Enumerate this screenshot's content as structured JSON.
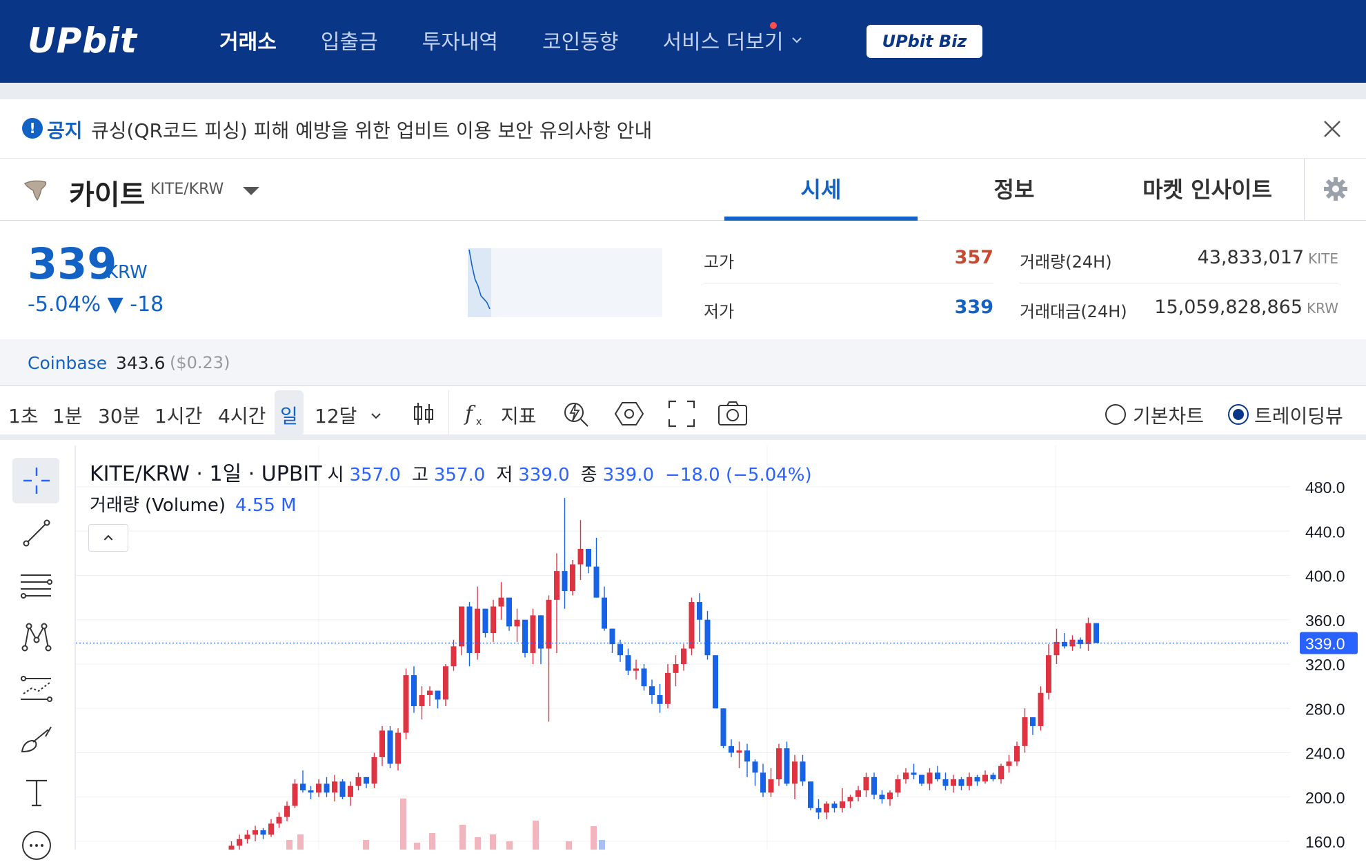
{
  "header": {
    "logo": "UPbit",
    "nav": [
      "거래소",
      "입출금",
      "투자내역",
      "코인동향",
      "서비스 더보기"
    ],
    "biz_button": "UPbit Biz"
  },
  "notice": {
    "tag": "공지",
    "text": "큐싱(QR코드 피싱) 피해 예방을 위한 업비트 이용 보안 유의사항 안내"
  },
  "coin": {
    "name": "카이트",
    "pair": "KITE/KRW",
    "tabs": [
      "시세",
      "정보",
      "마켓 인사이트"
    ]
  },
  "price": {
    "current": "339",
    "unit": "KRW",
    "change": "-5.04% ▼ -18",
    "high_label": "고가",
    "high": "357",
    "low_label": "저가",
    "low": "339",
    "volume_label": "거래량(24H)",
    "volume": "43,833,017",
    "volume_unit": "KITE",
    "turnover_label": "거래대금(24H)",
    "turnover": "15,059,828,865",
    "turnover_unit": "KRW",
    "mini_series": [
      357,
      352,
      348,
      346,
      343,
      342,
      341,
      339
    ]
  },
  "coinbase": {
    "label": "Coinbase",
    "value": "343.6",
    "usd": "($0.23)"
  },
  "toolbar": {
    "intervals": [
      "1초",
      "1분",
      "30분",
      "1시간",
      "4시간",
      "일",
      "12달"
    ],
    "indicator": "지표",
    "chart_basic": "기본차트",
    "chart_tv": "트레이딩뷰"
  },
  "legend": {
    "title": "KITE/KRW · 1일 · UPBIT",
    "o_label": "시",
    "o": "357.0",
    "h_label": "고",
    "h": "357.0",
    "l_label": "저",
    "l": "339.0",
    "c_label": "종",
    "c": "339.0",
    "change": "−18.0 (−5.04%)",
    "volume_label": "거래량 (Volume)",
    "volume": "4.55 M"
  },
  "colors": {
    "brand": "#093687",
    "up": "#e03342",
    "down": "#1763e8",
    "accent": "#1261c4"
  },
  "chart_data": {
    "type": "candlestick",
    "price_tag": "339.0",
    "ylim": [
      160,
      480
    ],
    "yticks": [
      "480.0",
      "440.0",
      "400.0",
      "360.0",
      "320.0",
      "280.0",
      "240.0",
      "200.0",
      "160.0"
    ],
    "candles": [
      [
        142,
        150,
        133,
        148
      ],
      [
        148,
        160,
        145,
        156
      ],
      [
        156,
        166,
        150,
        162
      ],
      [
        162,
        170,
        158,
        166
      ],
      [
        166,
        174,
        160,
        170
      ],
      [
        170,
        172,
        162,
        166
      ],
      [
        166,
        180,
        164,
        176
      ],
      [
        176,
        186,
        172,
        182
      ],
      [
        182,
        196,
        178,
        192
      ],
      [
        192,
        216,
        190,
        212
      ],
      [
        212,
        224,
        204,
        206
      ],
      [
        206,
        210,
        198,
        204
      ],
      [
        204,
        216,
        200,
        212
      ],
      [
        212,
        218,
        200,
        204
      ],
      [
        204,
        220,
        196,
        214
      ],
      [
        214,
        216,
        198,
        200
      ],
      [
        200,
        214,
        192,
        210
      ],
      [
        210,
        222,
        206,
        218
      ],
      [
        218,
        216,
        208,
        212
      ],
      [
        212,
        240,
        208,
        236
      ],
      [
        236,
        264,
        228,
        260
      ],
      [
        260,
        264,
        226,
        230
      ],
      [
        230,
        262,
        224,
        258
      ],
      [
        258,
        316,
        252,
        310
      ],
      [
        310,
        318,
        276,
        282
      ],
      [
        282,
        300,
        270,
        292
      ],
      [
        292,
        300,
        282,
        296
      ],
      [
        296,
        290,
        280,
        288
      ],
      [
        288,
        320,
        282,
        318
      ],
      [
        318,
        342,
        314,
        336
      ],
      [
        336,
        370,
        328,
        372
      ],
      [
        372,
        376,
        318,
        330
      ],
      [
        330,
        390,
        324,
        370
      ],
      [
        370,
        360,
        344,
        348
      ],
      [
        348,
        378,
        340,
        372
      ],
      [
        372,
        394,
        360,
        380
      ],
      [
        380,
        378,
        350,
        354
      ],
      [
        354,
        370,
        340,
        360
      ],
      [
        360,
        352,
        326,
        330
      ],
      [
        330,
        370,
        320,
        364
      ],
      [
        364,
        356,
        320,
        334
      ],
      [
        334,
        382,
        268,
        378
      ],
      [
        378,
        420,
        330,
        404
      ],
      [
        404,
        470,
        370,
        386
      ],
      [
        386,
        414,
        382,
        410
      ],
      [
        410,
        450,
        396,
        424
      ],
      [
        424,
        410,
        402,
        408
      ],
      [
        408,
        434,
        380,
        380
      ],
      [
        380,
        390,
        350,
        352
      ],
      [
        352,
        346,
        330,
        338
      ],
      [
        338,
        342,
        322,
        328
      ],
      [
        328,
        334,
        310,
        314
      ],
      [
        314,
        324,
        306,
        316
      ],
      [
        316,
        320,
        296,
        300
      ],
      [
        300,
        306,
        284,
        292
      ],
      [
        292,
        302,
        276,
        284
      ],
      [
        284,
        320,
        280,
        312
      ],
      [
        312,
        328,
        300,
        320
      ],
      [
        320,
        338,
        314,
        334
      ],
      [
        334,
        380,
        328,
        376
      ],
      [
        376,
        384,
        340,
        360
      ],
      [
        360,
        368,
        324,
        328
      ],
      [
        328,
        320,
        296,
        280
      ],
      [
        280,
        260,
        244,
        246
      ],
      [
        246,
        252,
        236,
        240
      ],
      [
        240,
        250,
        226,
        242
      ],
      [
        242,
        248,
        218,
        232
      ],
      [
        232,
        234,
        210,
        222
      ],
      [
        222,
        230,
        200,
        204
      ],
      [
        204,
        226,
        200,
        216
      ],
      [
        216,
        248,
        210,
        244
      ],
      [
        244,
        250,
        210,
        212
      ],
      [
        212,
        238,
        198,
        232
      ],
      [
        232,
        238,
        210,
        214
      ],
      [
        214,
        212,
        188,
        190
      ],
      [
        190,
        198,
        180,
        186
      ],
      [
        186,
        196,
        180,
        194
      ],
      [
        194,
        196,
        186,
        190
      ],
      [
        190,
        208,
        186,
        196
      ],
      [
        196,
        202,
        190,
        200
      ],
      [
        200,
        210,
        196,
        206
      ],
      [
        206,
        222,
        200,
        218
      ],
      [
        218,
        222,
        198,
        202
      ],
      [
        202,
        206,
        194,
        198
      ],
      [
        198,
        206,
        192,
        204
      ],
      [
        204,
        220,
        200,
        216
      ],
      [
        216,
        226,
        212,
        222
      ],
      [
        222,
        230,
        216,
        220
      ],
      [
        220,
        218,
        210,
        212
      ],
      [
        212,
        226,
        206,
        222
      ],
      [
        222,
        228,
        214,
        216
      ],
      [
        216,
        222,
        206,
        210
      ],
      [
        210,
        220,
        204,
        216
      ],
      [
        216,
        218,
        206,
        210
      ],
      [
        210,
        222,
        206,
        218
      ],
      [
        218,
        220,
        210,
        214
      ],
      [
        214,
        224,
        212,
        220
      ],
      [
        220,
        222,
        214,
        216
      ],
      [
        216,
        230,
        212,
        228
      ],
      [
        228,
        238,
        222,
        232
      ],
      [
        232,
        250,
        228,
        246
      ],
      [
        246,
        280,
        240,
        272
      ],
      [
        272,
        270,
        256,
        264
      ],
      [
        264,
        300,
        260,
        294
      ],
      [
        294,
        338,
        288,
        328
      ],
      [
        328,
        352,
        320,
        340
      ],
      [
        340,
        348,
        334,
        336
      ],
      [
        336,
        346,
        332,
        342
      ],
      [
        342,
        344,
        334,
        338
      ],
      [
        338,
        362,
        332,
        357
      ],
      [
        357,
        357,
        339,
        339
      ]
    ]
  }
}
